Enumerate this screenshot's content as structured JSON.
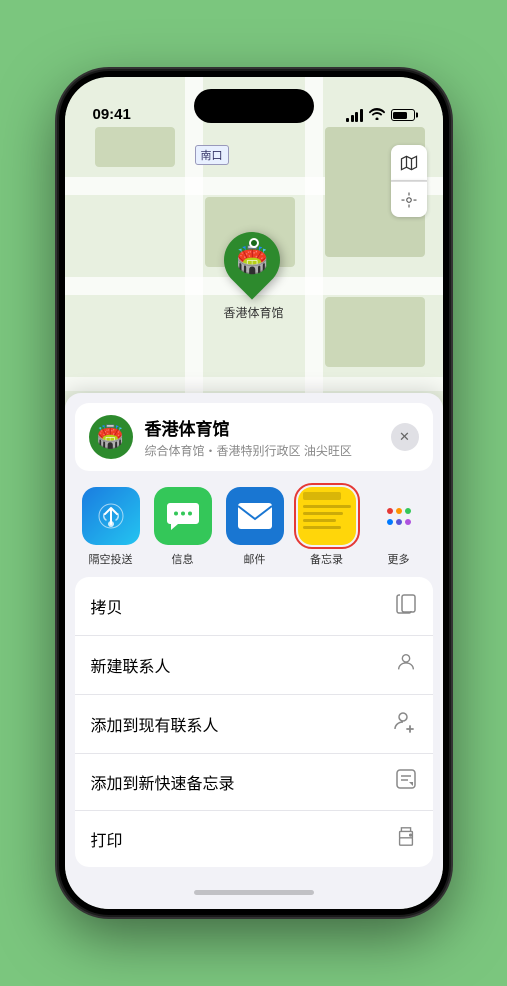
{
  "phone": {
    "time": "09:41",
    "location_name": "香港体育馆",
    "location_sub": "综合体育馆・香港特别行政区 油尖旺区",
    "map_label": "南口",
    "pin_label": "香港体育馆",
    "close_btn": "×",
    "controls": {
      "map_icon": "🗺",
      "location_icon": "➤"
    }
  },
  "share_items": [
    {
      "label": "隔空投送",
      "type": "airdrop"
    },
    {
      "label": "信息",
      "type": "messages"
    },
    {
      "label": "邮件",
      "type": "mail"
    },
    {
      "label": "备忘录",
      "type": "notes",
      "highlighted": true
    },
    {
      "label": "更多",
      "type": "more"
    }
  ],
  "action_rows": [
    {
      "label": "拷贝",
      "icon": "copy"
    },
    {
      "label": "新建联系人",
      "icon": "person"
    },
    {
      "label": "添加到现有联系人",
      "icon": "person-add"
    },
    {
      "label": "添加到新快速备忘录",
      "icon": "note"
    },
    {
      "label": "打印",
      "icon": "printer"
    }
  ],
  "colors": {
    "green": "#2d8a2d",
    "highlight_red": "#e53935",
    "bg": "#7bc67e"
  }
}
